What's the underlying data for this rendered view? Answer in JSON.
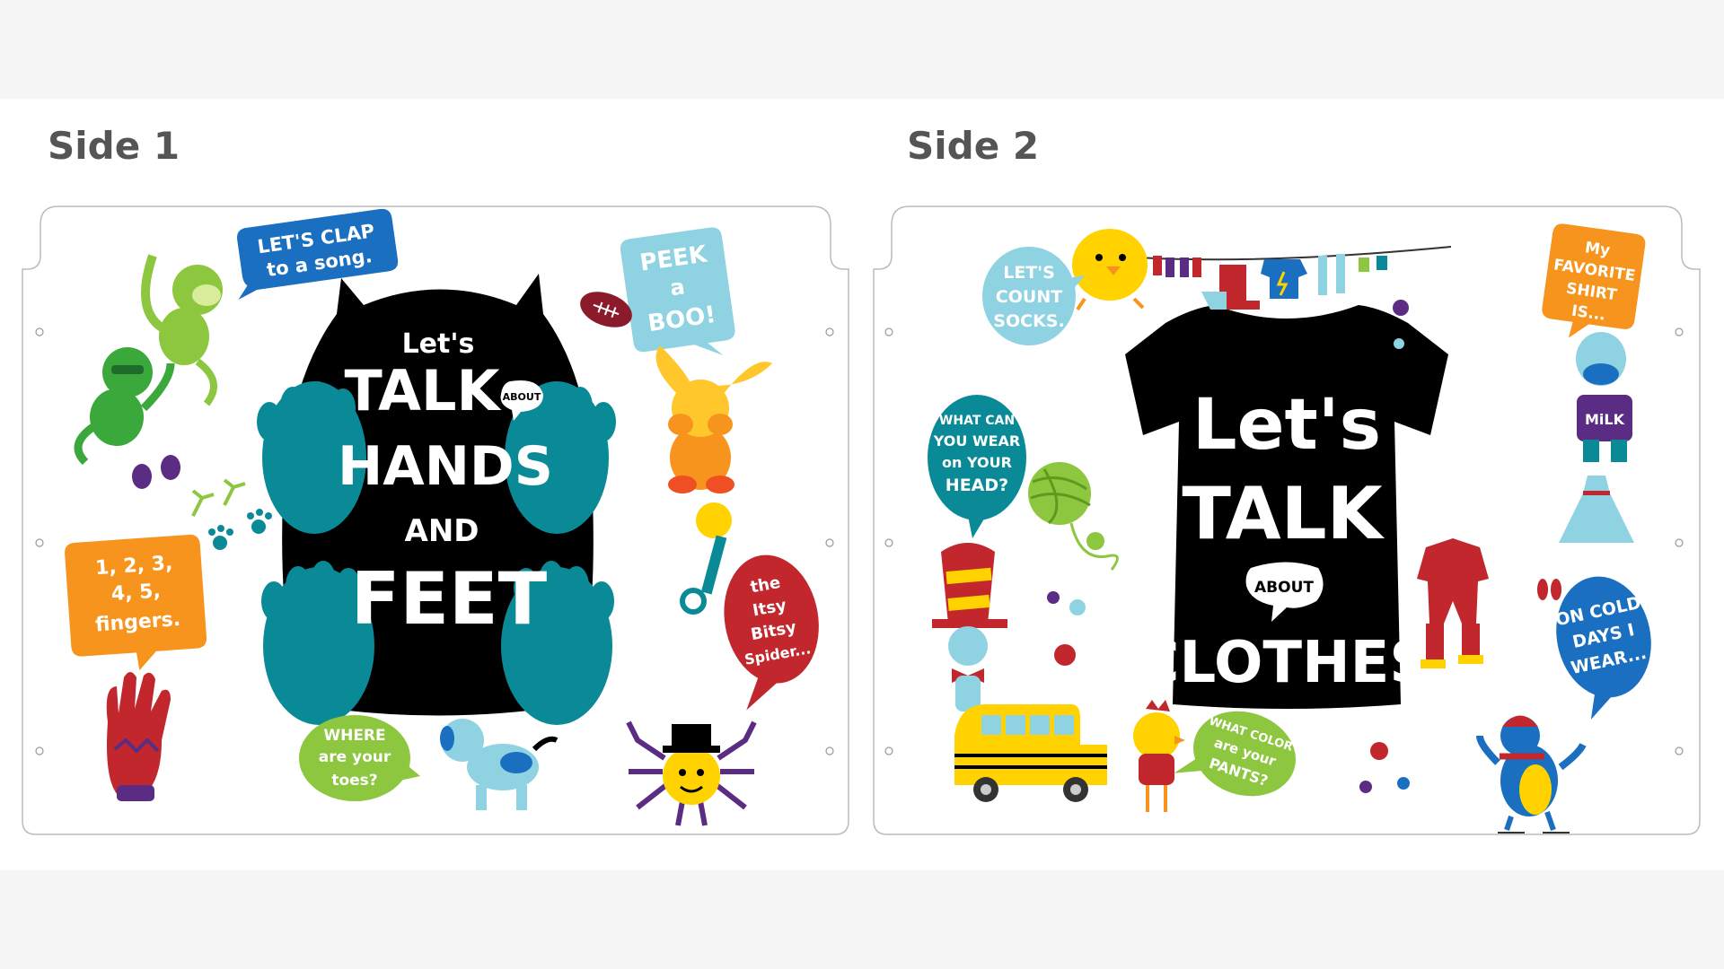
{
  "side1": {
    "title": "Side 1",
    "headline": {
      "lets": "Let's",
      "talk": "TALK",
      "about": "ABOUT",
      "hands": "HANDS",
      "and": "AND",
      "feet": "FEET"
    },
    "bubbles": {
      "clap": [
        "LET'S CLAP",
        "to a song."
      ],
      "peek": [
        "PEEK",
        "a",
        "BOO!"
      ],
      "count": [
        "1, 2, 3,",
        "4, 5,",
        "fingers."
      ],
      "spider": [
        "the",
        "Itsy",
        "Bitsy",
        "Spider..."
      ],
      "toes": [
        "WHERE",
        "are your",
        "toes?"
      ]
    }
  },
  "side2": {
    "title": "Side 2",
    "headline": {
      "lets": "Let's",
      "talk": "TALK",
      "about": "ABOUT",
      "clothes": "CLOTHES"
    },
    "bubbles": {
      "socks": [
        "LET'S",
        "COUNT",
        "SOCKS."
      ],
      "shirt": [
        "My",
        "FAVORITE",
        "SHIRT",
        "IS..."
      ],
      "head": [
        "WHAT CAN",
        "YOU WEAR",
        "on YOUR",
        "HEAD?"
      ],
      "cold": [
        "ON COLD",
        "DAYS I",
        "WEAR..."
      ],
      "pants": [
        "WHAT COLOR",
        "are your",
        "PANTS?"
      ]
    },
    "milk": "MiLK"
  },
  "colors": {
    "teal": "#0a8a96",
    "blue": "#1a6fc0",
    "lightblue": "#8fd3e3",
    "orange": "#f7941d",
    "green": "#8dc63f",
    "crimson": "#c1272d",
    "yellow": "#ffd200",
    "purple": "#5b2c83",
    "black": "#000000"
  }
}
